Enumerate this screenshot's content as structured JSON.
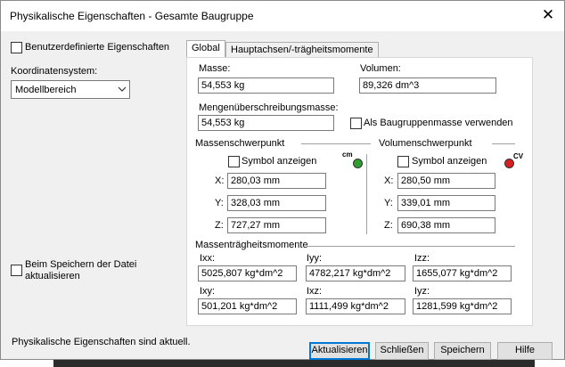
{
  "window": {
    "title": "Physikalische Eigenschaften - Gesamte Baugruppe",
    "close_glyph": "✕"
  },
  "left": {
    "custom_props_label": "Benutzerdefinierte Eigenschaften",
    "coord_label": "Koordinatensystem:",
    "coord_value": "Modellbereich",
    "update_on_save_label": "Beim Speichern der Datei aktualisieren"
  },
  "tabs": [
    {
      "label": "Global",
      "active": true
    },
    {
      "label": "Hauptachsen/-trägheitsmomente",
      "active": false
    }
  ],
  "global": {
    "mass_label": "Masse:",
    "mass_value": "54,553 kg",
    "volume_label": "Volumen:",
    "volume_value": "89,326 dm^3",
    "quantity_mass_label": "Mengenüberschreibungsmasse:",
    "quantity_mass_value": "54,553 kg",
    "use_assembly_mass_label": "Als Baugruppenmasse verwenden",
    "center_of_mass": {
      "title": "Massenschwerpunkt",
      "symbol_label": "Symbol anzeigen",
      "icon_text": "cm",
      "icon_color": "#2e9e2e",
      "x_label": "X:",
      "x_value": "280,03 mm",
      "y_label": "Y:",
      "y_value": "328,03 mm",
      "z_label": "Z:",
      "z_value": "727,27 mm"
    },
    "center_of_volume": {
      "title": "Volumenschwerpunkt",
      "symbol_label": "Symbol anzeigen",
      "icon_text": "CV",
      "icon_color": "#d81e1e",
      "x_label": "X:",
      "x_value": "280,50 mm",
      "y_label": "Y:",
      "y_value": "339,01 mm",
      "z_label": "Z:",
      "z_value": "690,38 mm"
    },
    "inertia": {
      "title": "Massenträgheitsmomente",
      "ixx_label": "Ixx:",
      "ixx_value": "5025,807 kg*dm^2",
      "iyy_label": "Iyy:",
      "iyy_value": "4782,217 kg*dm^2",
      "izz_label": "Izz:",
      "izz_value": "1655,077 kg*dm^2",
      "ixy_label": "Ixy:",
      "ixy_value": "501,201 kg*dm^2",
      "ixz_label": "Ixz:",
      "ixz_value": "1111,499 kg*dm^2",
      "iyz_label": "Iyz:",
      "iyz_value": "1281,599 kg*dm^2"
    }
  },
  "status": "Physikalische Eigenschaften sind aktuell.",
  "buttons": {
    "update": "Aktualisieren",
    "close": "Schließen",
    "save": "Speichern",
    "help": "Hilfe"
  }
}
